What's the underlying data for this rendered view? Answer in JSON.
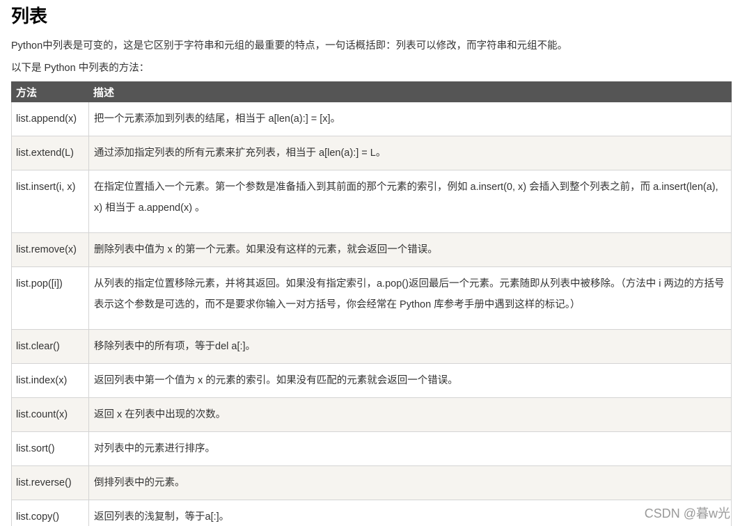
{
  "title": "列表",
  "intro": "Python中列表是可变的，这是它区别于字符串和元组的最重要的特点，一句话概括即：列表可以修改，而字符串和元组不能。",
  "subtitle": "以下是 Python 中列表的方法：",
  "table": {
    "headers": [
      "方法",
      "描述"
    ],
    "rows": [
      {
        "method": "list.append(x)",
        "desc": "把一个元素添加到列表的结尾，相当于 a[len(a):] = [x]。"
      },
      {
        "method": "list.extend(L)",
        "desc": "通过添加指定列表的所有元素来扩充列表，相当于 a[len(a):] = L。"
      },
      {
        "method": "list.insert(i, x)",
        "desc": "在指定位置插入一个元素。第一个参数是准备插入到其前面的那个元素的索引，例如 a.insert(0, x) 会插入到整个列表之前，而 a.insert(len(a), x) 相当于 a.append(x) 。"
      },
      {
        "method": "list.remove(x)",
        "desc": "删除列表中值为 x 的第一个元素。如果没有这样的元素，就会返回一个错误。"
      },
      {
        "method": "list.pop([i])",
        "desc": "从列表的指定位置移除元素，并将其返回。如果没有指定索引，a.pop()返回最后一个元素。元素随即从列表中被移除。（方法中 i 两边的方括号表示这个参数是可选的，而不是要求你输入一对方括号，你会经常在 Python 库参考手册中遇到这样的标记。）"
      },
      {
        "method": "list.clear()",
        "desc": "移除列表中的所有项，等于del a[:]。"
      },
      {
        "method": "list.index(x)",
        "desc": "返回列表中第一个值为 x 的元素的索引。如果没有匹配的元素就会返回一个错误。"
      },
      {
        "method": "list.count(x)",
        "desc": "返回 x 在列表中出现的次数。"
      },
      {
        "method": "list.sort()",
        "desc": "对列表中的元素进行排序。"
      },
      {
        "method": "list.reverse()",
        "desc": "倒排列表中的元素。"
      },
      {
        "method": "list.copy()",
        "desc": "返回列表的浅复制，等于a[:]。"
      }
    ]
  },
  "watermark": "CSDN @暮w光"
}
